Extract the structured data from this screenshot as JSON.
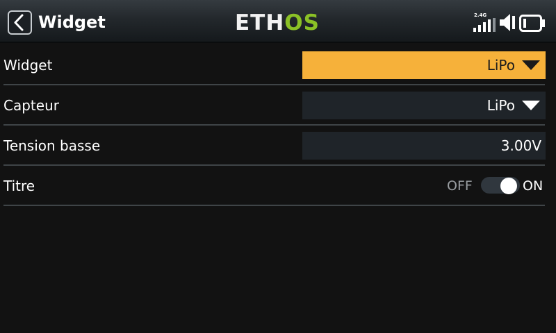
{
  "header": {
    "title": "Widget",
    "logo": {
      "part1": "ETH",
      "part2": "OS"
    },
    "band_label": "2.4G",
    "icons": {
      "back": "chevron-left-icon",
      "signal": "signal-bars-icon",
      "volume": "speaker-icon",
      "battery": "battery-icon"
    }
  },
  "rows": [
    {
      "label": "Widget",
      "value": "LiPo",
      "type": "dropdown",
      "focused": true
    },
    {
      "label": "Capteur",
      "value": "LiPo",
      "type": "dropdown"
    },
    {
      "label": "Tension basse",
      "value": "3.00V",
      "type": "number"
    },
    {
      "label": "Titre",
      "off_label": "OFF",
      "on_label": "ON",
      "type": "toggle",
      "state": "on"
    }
  ],
  "colors": {
    "accent": "#f6b13a",
    "logo_green": "#8bc126",
    "background": "#121212",
    "field_bg": "#1f2429"
  }
}
